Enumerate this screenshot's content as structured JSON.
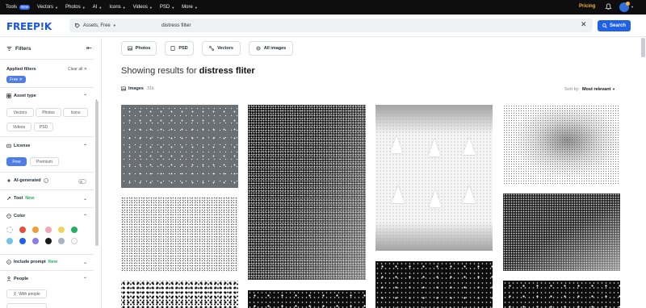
{
  "topbar": {
    "nav": [
      {
        "label": "Tools",
        "badge": "New"
      },
      {
        "label": "Vectors"
      },
      {
        "label": "Photos"
      },
      {
        "label": "AI"
      },
      {
        "label": "Icons"
      },
      {
        "label": "Videos"
      },
      {
        "label": "PSD"
      },
      {
        "label": "More"
      }
    ],
    "pricing": "Pricing",
    "colors": {
      "pricing": "#f7b23b",
      "accent": "#1f61e8"
    }
  },
  "header": {
    "logo": "FREEP!K",
    "scope": "Assets, Free",
    "query": "distress filter",
    "search_button": "Search"
  },
  "sidebar": {
    "title": "Filters",
    "applied_filters": "Applied filters",
    "clear_all": "Clear all",
    "applied_chip": "Free",
    "asset_type": {
      "title": "Asset type",
      "options": [
        "Vectors",
        "Photos",
        "Icons",
        "Videos",
        "PSD"
      ]
    },
    "license": {
      "title": "License",
      "options": [
        "Free",
        "Premium"
      ],
      "selected": "Free"
    },
    "ai_generated": {
      "title": "AI-generated",
      "info": "i"
    },
    "tool": {
      "title": "Tool",
      "badge": "New"
    },
    "color": {
      "title": "Color",
      "swatches": [
        "#e74c3c",
        "#f39c34",
        "#f4a6b8",
        "#f1d35b",
        "#27ae60",
        "#6fc3ef",
        "#1f61e8",
        "#8e7be8",
        "#1a1a1a",
        "#a9b3be",
        "#ffffff"
      ]
    },
    "include_prompt": {
      "title": "Include prompt",
      "badge": "New"
    },
    "people": {
      "title": "People",
      "options": [
        "With people"
      ]
    }
  },
  "main": {
    "type_tabs": [
      "Photos",
      "PSD",
      "Vectors",
      "All images"
    ],
    "results_prefix": "Showing results for",
    "results_query": "distress fliter",
    "images_label": "Images",
    "images_count": "31k",
    "sort_label": "Sort by:",
    "sort_value": "Most relevant"
  }
}
